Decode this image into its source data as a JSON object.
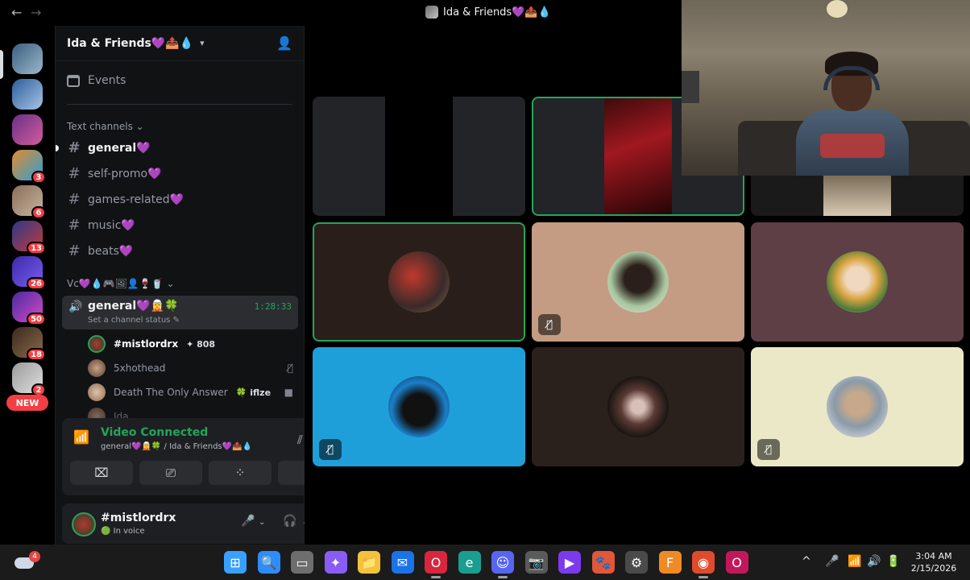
{
  "window": {
    "title": "Ida & Friends💜📤💧",
    "back": "←",
    "forward": "→"
  },
  "rail": {
    "badges": [
      "3",
      "6",
      "13",
      "26",
      "50",
      "18",
      "2"
    ],
    "new_label": "NEW"
  },
  "sidebar": {
    "server_name": "Ida & Friends💜📤💧",
    "events_label": "Events",
    "text_category": "Text channels",
    "text_channels": [
      {
        "name": "general💜"
      },
      {
        "name": "self-promo💜"
      },
      {
        "name": "games-related💜"
      },
      {
        "name": "music💜"
      },
      {
        "name": "beats💜"
      }
    ],
    "voice_category": "Vc💜💧🎮🖼👤🍷🥤",
    "voice_channel": {
      "name": "general💜🧝🍀",
      "timer": "1:28:33",
      "status": "Set a channel status ✎"
    },
    "voice_users": [
      {
        "name": "#mistlordrx",
        "tag": "✦ 808",
        "icon": "",
        "color": "#ffffff"
      },
      {
        "name": "5xhothead",
        "tag": "",
        "icon": "mic-muted-icon",
        "color": "#949ba4"
      },
      {
        "name": "Death The Only Answer",
        "tag": "🍀 iflze",
        "icon": "camera-icon",
        "color": "#949ba4"
      },
      {
        "name": "Ida",
        "tag": "",
        "icon": "",
        "color": "#949ba4"
      }
    ]
  },
  "voice_panel": {
    "title": "Video Connected",
    "subtitle": "general💜🧝🍀 / Ida & Friends💜📤💧"
  },
  "user_panel": {
    "username": "#mistlordrx",
    "status": "🟢 In voice"
  },
  "stage": {
    "tiles": [
      {
        "bg": "#232428",
        "kind": "blank",
        "speaking": false,
        "muted": false
      },
      {
        "bg": "#232428",
        "kind": "red",
        "speaking": true,
        "muted": false
      },
      {
        "bg": "#1a1a1a",
        "kind": "cam-hidden",
        "speaking": false,
        "muted": false
      },
      {
        "bg": "#2a1e1a",
        "kind": "avatar",
        "speaking": true,
        "muted": false
      },
      {
        "bg": "#c49c83",
        "kind": "avatar",
        "speaking": false,
        "muted": true
      },
      {
        "bg": "#5e3f45",
        "kind": "avatar",
        "speaking": false,
        "muted": false
      },
      {
        "bg": "#1f9fd9",
        "kind": "avatar",
        "speaking": false,
        "muted": true
      },
      {
        "bg": "#2a211c",
        "kind": "avatar",
        "speaking": false,
        "muted": false
      },
      {
        "bg": "#ebe8c8",
        "kind": "avatar",
        "speaking": false,
        "muted": true
      }
    ]
  },
  "taskbar": {
    "weather_badge": "4",
    "time": "3:04 AM",
    "date": "2/15/2026",
    "apps": [
      {
        "name": "start-button",
        "glyph": "⊞",
        "color": "#3aa0ff"
      },
      {
        "name": "search-button",
        "glyph": "🔍",
        "color": "#2d8cff"
      },
      {
        "name": "task-view-button",
        "glyph": "▭",
        "color": "#6e6e6e"
      },
      {
        "name": "copilot-button",
        "glyph": "✦",
        "color": "#8a5cf6"
      },
      {
        "name": "file-explorer-button",
        "glyph": "📁",
        "color": "#f3c23c"
      },
      {
        "name": "outlook-button",
        "glyph": "✉",
        "color": "#1a73e8"
      },
      {
        "name": "opera-button",
        "glyph": "O",
        "color": "#d7263d"
      },
      {
        "name": "edge-button",
        "glyph": "e",
        "color": "#1a9e8f"
      },
      {
        "name": "discord-button",
        "glyph": "☺",
        "color": "#5865f2"
      },
      {
        "name": "camera-button",
        "glyph": "📷",
        "color": "#5a5a5a"
      },
      {
        "name": "clipchamp-button",
        "glyph": "▶",
        "color": "#7c3aed"
      },
      {
        "name": "app-button",
        "glyph": "🐾",
        "color": "#e0573a"
      },
      {
        "name": "settings-button",
        "glyph": "⚙",
        "color": "#4a4a4a"
      },
      {
        "name": "fl-studio-button",
        "glyph": "F",
        "color": "#f08a24"
      },
      {
        "name": "chrome-button",
        "glyph": "◉",
        "color": "#e04b2d"
      },
      {
        "name": "opera-gx-button",
        "glyph": "O",
        "color": "#c2185b"
      }
    ],
    "tray": [
      "^",
      "🎤",
      "📶",
      "🔊",
      "🔋"
    ]
  }
}
